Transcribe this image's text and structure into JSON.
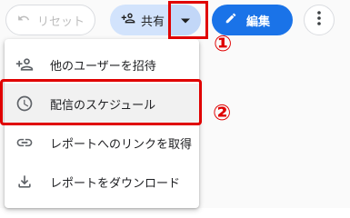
{
  "toolbar": {
    "reset_label": "リセット",
    "share_label": "共有",
    "edit_label": "編集"
  },
  "annotations": {
    "marker1": "①",
    "marker2": "②",
    "color": "#e00000"
  },
  "menu": {
    "items": [
      {
        "label": "他のユーザーを招待",
        "icon": "person-add-icon"
      },
      {
        "label": "配信のスケジュール",
        "icon": "clock-icon"
      },
      {
        "label": "レポートへのリンクを取得",
        "icon": "link-icon"
      },
      {
        "label": "レポートをダウンロード",
        "icon": "download-icon"
      }
    ]
  },
  "colors": {
    "accent": "#1a73e8",
    "share_bg": "#d2e3fc"
  }
}
